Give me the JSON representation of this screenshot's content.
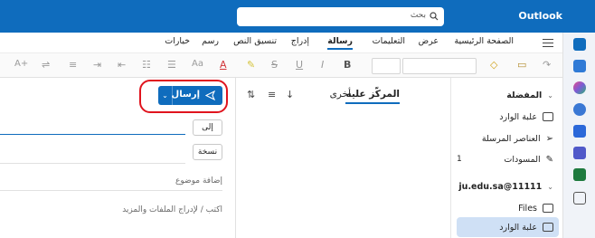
{
  "app": {
    "brand": "Outlook"
  },
  "search": {
    "placeholder": "بحث"
  },
  "ribbon_tabs": [
    "الصفحة الرئيسية",
    "عرض",
    "التعليمات",
    "رسالة",
    "إدراج",
    "تنسيق النص",
    "رسم",
    "خيارات"
  ],
  "active_tab": "رسالة",
  "toolbar_glyphs": {
    "bold": "B",
    "italic": "I",
    "underline": "U",
    "strike": "S",
    "font_color": "A",
    "grow": "A+",
    "format": "Aa"
  },
  "nav": {
    "favorites": "المفضلة",
    "inbox": "علبة الوارد",
    "sent": "العناصر المرسلة",
    "drafts": "المسودات",
    "drafts_count": "1",
    "account": "ju.edu.sa@11111",
    "files": "Files",
    "inbox2": "علبة الوارد"
  },
  "list": {
    "focused": "المركّز عليه",
    "other": "أخرى"
  },
  "compose": {
    "send": "إرسال",
    "to": "إلى",
    "cc": "نسخة",
    "subject_placeholder": "إضافة موضوع",
    "body_placeholder": "اكتب / لإدراج الملفات والمزيد"
  },
  "colors": {
    "accent": "#0f6cbd",
    "highlight": "#e0141e"
  }
}
